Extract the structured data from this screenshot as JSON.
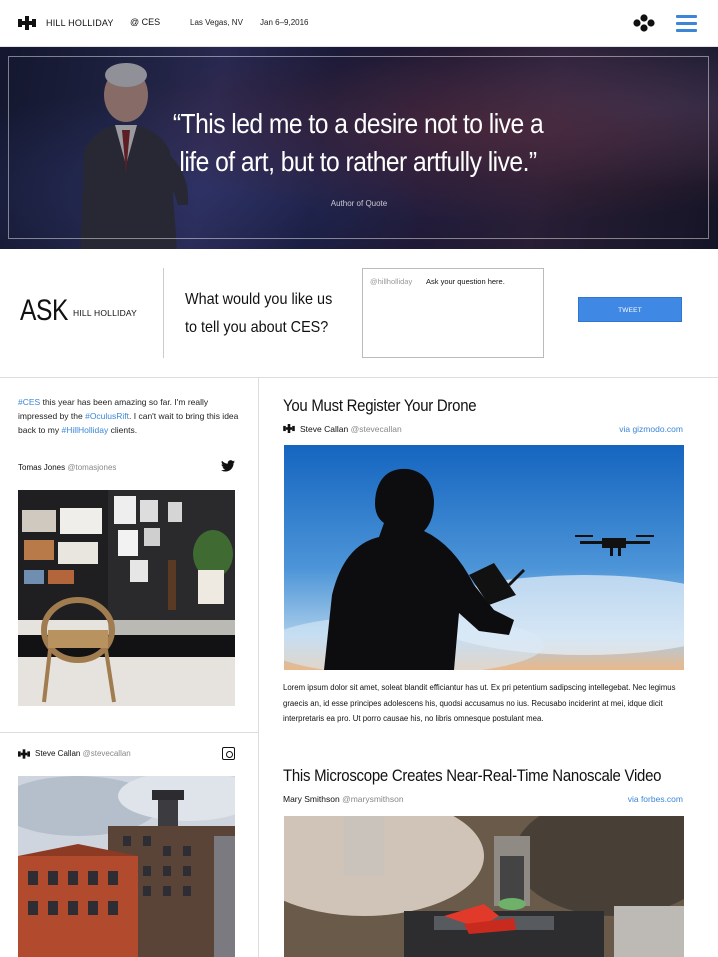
{
  "topbar": {
    "brand": "HILL HOLLIDAY",
    "event": "@ CES",
    "location": "Las Vegas, NV",
    "dates": "Jan 6–9,2016",
    "accent": "#3b86d8"
  },
  "hero": {
    "quote_line1": "“This led me to a desire not to live a",
    "quote_line2": "life of art, but to rather artfully live.”",
    "author": "Author of Quote"
  },
  "ask": {
    "word": "ASK",
    "brand": "HILL HOLLIDAY",
    "prompt_line1": "What would you like us",
    "prompt_line2": "to tell you about CES?",
    "handle": "@hillholliday",
    "placeholder": "Ask your question here.",
    "button": "TWEET",
    "button_color": "#3f88e3"
  },
  "feed_left": {
    "tweet": {
      "segments": [
        {
          "text": "#CES",
          "tag": true
        },
        {
          "text": " this year has been amazing so far. I'm really impressed by the ",
          "tag": false
        },
        {
          "text": "#OculusRift",
          "tag": true
        },
        {
          "text": ". I can't wait to bring this idea back to my ",
          "tag": false
        },
        {
          "text": "#HillHolliday",
          "tag": true
        },
        {
          "text": " clients.",
          "tag": false
        }
      ],
      "author_name": "Tomas Jones",
      "author_handle": "@tomasjones",
      "icon": "twitter-icon"
    },
    "instagram": {
      "author_name": "Steve Callan",
      "author_handle": "@stevecallan",
      "icon": "instagram-icon"
    }
  },
  "articles": [
    {
      "title": "You Must Register Your Drone",
      "author_name": "Steve Callan",
      "author_handle": "@stevecallan",
      "via": "via gizmodo.com",
      "body": "Lorem ipsum dolor sit amet, soleat blandit efficiantur has ut. Ex pri petentium sadipscing intellegebat. Nec legimus graecis an, id esse principes adolescens his, quodsi accusamus no ius. Recusabo inciderint at mei, idque dicit interpretaris ea pro. Ut porro causae his, no libris omnesque postulant mea."
    },
    {
      "title": "This Microscope Creates Near-Real-Time Nanoscale Video",
      "author_name": "Mary Smithson",
      "author_handle": "@marysmithson",
      "via": "via forbes.com"
    }
  ]
}
